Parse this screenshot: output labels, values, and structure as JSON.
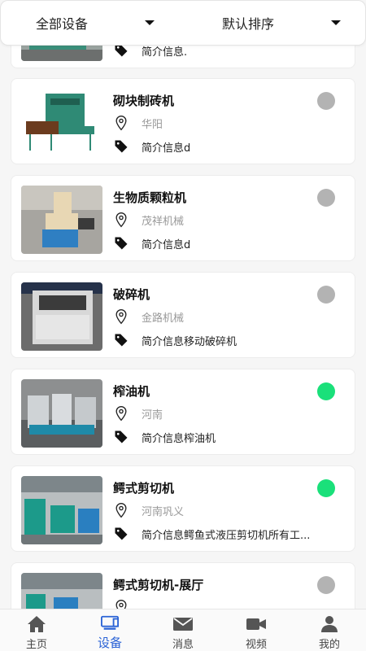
{
  "filters": {
    "category": "全部设备",
    "sort": "默认排序"
  },
  "devices": [
    {
      "title": "",
      "location": "",
      "intro": "简介信息.",
      "status": "off"
    },
    {
      "title": "砌块制砖机",
      "location": "华阳",
      "intro": "简介信息d",
      "status": "off"
    },
    {
      "title": "生物质颗粒机",
      "location": "茂祥机械",
      "intro": "简介信息d",
      "status": "off"
    },
    {
      "title": "破碎机",
      "location": "金路机械",
      "intro": "简介信息移动破碎机",
      "status": "off"
    },
    {
      "title": "榨油机",
      "location": "河南",
      "intro": "简介信息榨油机",
      "status": "on"
    },
    {
      "title": "鳄式剪切机",
      "location": "河南巩义",
      "intro": "简介信息鳄鱼式液压剪切机所有工...",
      "status": "on"
    },
    {
      "title": "鳄式剪切机-展厅",
      "location": "",
      "intro": "",
      "status": "off"
    }
  ],
  "colors": {
    "status_on": "#1ae07a",
    "status_off": "#b3b3b3",
    "tab_active": "#2a63d6"
  },
  "tabbar": {
    "items": [
      {
        "label": "主页",
        "icon": "home-icon",
        "active": false
      },
      {
        "label": "设备",
        "icon": "device-icon",
        "active": true
      },
      {
        "label": "消息",
        "icon": "mail-icon",
        "active": false
      },
      {
        "label": "视频",
        "icon": "video-icon",
        "active": false
      },
      {
        "label": "我的",
        "icon": "user-icon",
        "active": false
      }
    ]
  }
}
